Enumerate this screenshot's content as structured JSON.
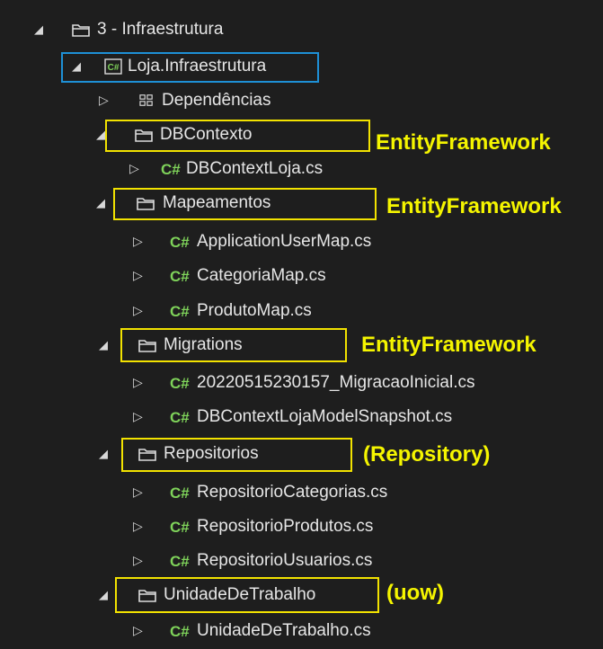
{
  "tree": {
    "infra_folder": "3 - Infraestrutura",
    "project": "Loja.Infraestrutura",
    "dependencies": "Dependências",
    "dbcontexto": "DBContexto",
    "dbcontext_file": "DBContextLoja.cs",
    "mapeamentos": "Mapeamentos",
    "map_files": [
      "ApplicationUserMap.cs",
      "CategoriaMap.cs",
      "ProdutoMap.cs"
    ],
    "migrations": "Migrations",
    "migration_files": [
      "20220515230157_MigracaoInicial.cs",
      "DBContextLojaModelSnapshot.cs"
    ],
    "repositorios": "Repositorios",
    "repo_files": [
      "RepositorioCategorias.cs",
      "RepositorioProdutos.cs",
      "RepositorioUsuarios.cs"
    ],
    "unidade": "UnidadeDeTrabalho",
    "unidade_file": "UnidadeDeTrabalho.cs"
  },
  "annotations": {
    "dbcontexto": "EntityFramework",
    "mapeamentos": "EntityFramework",
    "migrations": "EntityFramework",
    "repositorios": "(Repository)",
    "unidade": "(uow)"
  },
  "icons": {
    "expanded": "triangle-expanded-icon",
    "collapsed": "triangle-collapsed-icon",
    "folder": "folder-icon",
    "csharp": "csharp-file-icon",
    "project": "csharp-project-icon",
    "dependencies": "dependencies-icon"
  },
  "colors": {
    "background": "#1e1e1e",
    "highlight_yellow": "#f2e200",
    "highlight_blue": "#1e90d6",
    "annotation": "#f5f500",
    "csharp_icon": "#7fd35a"
  }
}
